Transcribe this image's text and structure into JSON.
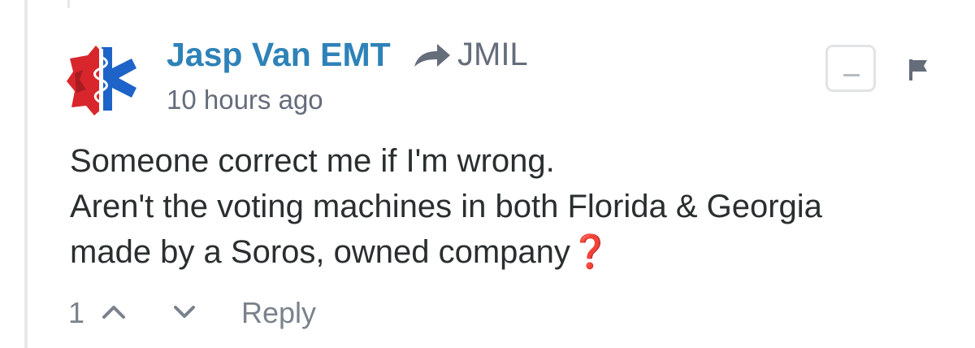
{
  "comment": {
    "author": "Jasp Van EMT",
    "reply_to": "JMIL",
    "timestamp": "10 hours ago",
    "message_lines": [
      "Someone correct me if I'm wrong.",
      "Aren't the voting machines in both Florida & Georgia",
      "made by a Soros, owned company"
    ],
    "message_end_emoji": "❓",
    "vote_count": "1",
    "reply_label": "Reply"
  },
  "icons": {
    "avatar": "star-of-life-logo",
    "reply_arrow": "reply-arrow-icon",
    "collapse": "minus-icon",
    "flag": "flag-icon",
    "upvote": "chevron-up-icon",
    "downvote": "chevron-down-icon"
  },
  "colors": {
    "author": "#2e82b8",
    "meta": "#656c7a",
    "text": "#2a2e2e",
    "accent_red": "#d0282e"
  }
}
